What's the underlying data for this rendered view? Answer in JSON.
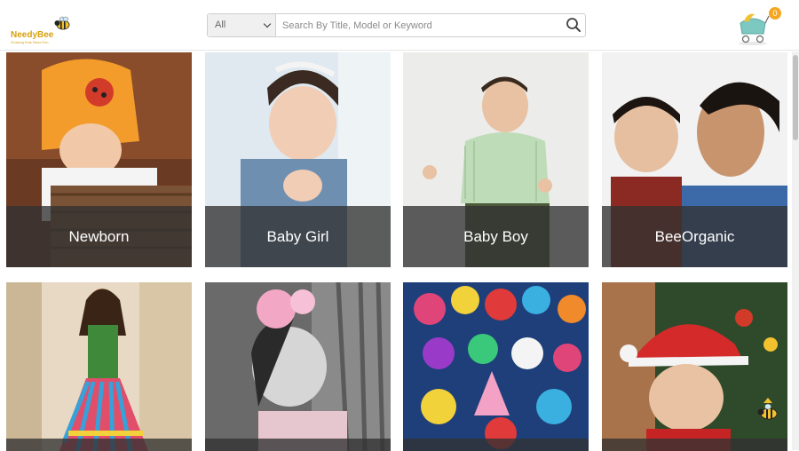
{
  "brand": {
    "name": "NeedyBee",
    "tagline": "Growing Kids Need Fun"
  },
  "search": {
    "category": "All",
    "placeholder": "Search By Title, Model or Keyword"
  },
  "cart": {
    "count": "0"
  },
  "categories": [
    {
      "label": "Newborn"
    },
    {
      "label": "Baby Girl"
    },
    {
      "label": "Baby Boy"
    },
    {
      "label": "BeeOrganic"
    },
    {
      "label": ""
    },
    {
      "label": ""
    },
    {
      "label": ""
    },
    {
      "label": ""
    }
  ],
  "colors": {
    "brand": "#d7a10c",
    "badge": "#f5a623",
    "caption_bg": "#323232"
  }
}
